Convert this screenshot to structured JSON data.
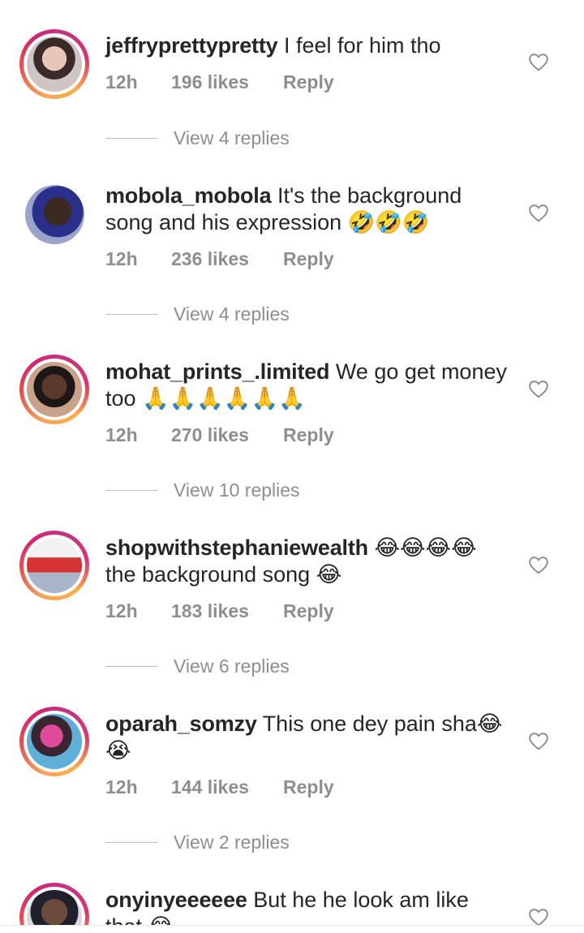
{
  "comments": [
    {
      "username": "jeffryprettypretty",
      "text": " I feel for him tho",
      "time": "12h",
      "likes": "196 likes",
      "reply": "Reply",
      "view_replies": "View 4 replies"
    },
    {
      "username": "mobola_mobola",
      "text": " It's the background song and his expression 🤣🤣🤣",
      "time": "12h",
      "likes": "236 likes",
      "reply": "Reply",
      "view_replies": "View 4 replies"
    },
    {
      "username": "mohat_prints_.limited",
      "text": " We go get money too 🙏🙏🙏🙏🙏🙏",
      "time": "12h",
      "likes": "270 likes",
      "reply": "Reply",
      "view_replies": "View 10 replies"
    },
    {
      "username": "shopwithstephaniewealth",
      "text": " 😂😂😂😂 the background song 😂",
      "time": "12h",
      "likes": "183 likes",
      "reply": "Reply",
      "view_replies": "View 6 replies"
    },
    {
      "username": "oparah_somzy",
      "text": " This one dey pain sha😂 😭",
      "time": "12h",
      "likes": "144 likes",
      "reply": "Reply",
      "view_replies": "View 2 replies"
    },
    {
      "username": "onyinyeeeeee",
      "text": " But he he look am like that 😂"
    }
  ],
  "icons": {
    "like": "heart-outline-icon"
  },
  "colors": {
    "story_ring": "#e1306c",
    "meta_text": "#8e8e8e"
  }
}
